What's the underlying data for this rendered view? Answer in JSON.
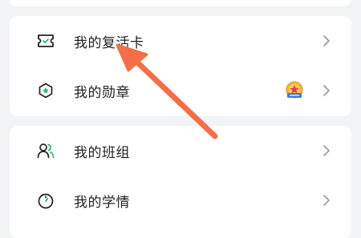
{
  "menu_group_1": {
    "items": [
      {
        "label": "我的复活卡",
        "icon": "ticket-icon"
      },
      {
        "label": "我的勋章",
        "icon": "medal-icon",
        "badge_icon": "star-badge-icon"
      }
    ]
  },
  "menu_group_2": {
    "items": [
      {
        "label": "我的班组",
        "icon": "group-users-icon"
      },
      {
        "label": "我的学情",
        "icon": "stopwatch-icon"
      }
    ]
  },
  "colors": {
    "background": "#f2f3f5",
    "card": "#ffffff",
    "accent_green": "#2fb873",
    "annotation_arrow": "#f36f47",
    "chevron": "#9a9a9a"
  }
}
